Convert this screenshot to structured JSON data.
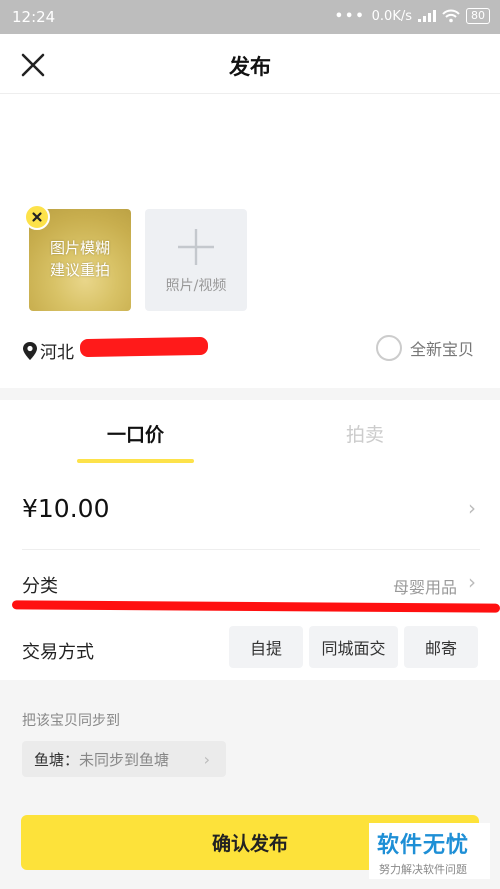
{
  "status_bar": {
    "time": "12:24",
    "net_speed": "0.0K/s",
    "battery": "80"
  },
  "header": {
    "title": "发布",
    "close_icon": "close-icon"
  },
  "media": {
    "photo_hint_line1": "图片模糊",
    "photo_hint_line2": "建议重拍",
    "add_label": "照片/视频"
  },
  "location": {
    "province": "河北"
  },
  "new_item": {
    "label": "全新宝贝",
    "checked": false
  },
  "tabs": [
    {
      "label": "一口价",
      "active": true
    },
    {
      "label": "拍卖",
      "active": false
    }
  ],
  "price": {
    "value": "¥10.00"
  },
  "category": {
    "label": "分类",
    "value": "母婴用品"
  },
  "trade": {
    "label": "交易方式",
    "options": [
      "自提",
      "同城面交",
      "邮寄"
    ]
  },
  "sync": {
    "label": "把该宝贝同步到",
    "pond_key": "鱼塘：",
    "pond_value": "未同步到鱼塘"
  },
  "confirm_label": "确认发布",
  "watermark": {
    "title": "软件无忧",
    "subtitle": "努力解决软件问题"
  },
  "colors": {
    "accent": "#fde23a",
    "redaction": "#ff1010",
    "watermark": "#1e8fd6"
  }
}
